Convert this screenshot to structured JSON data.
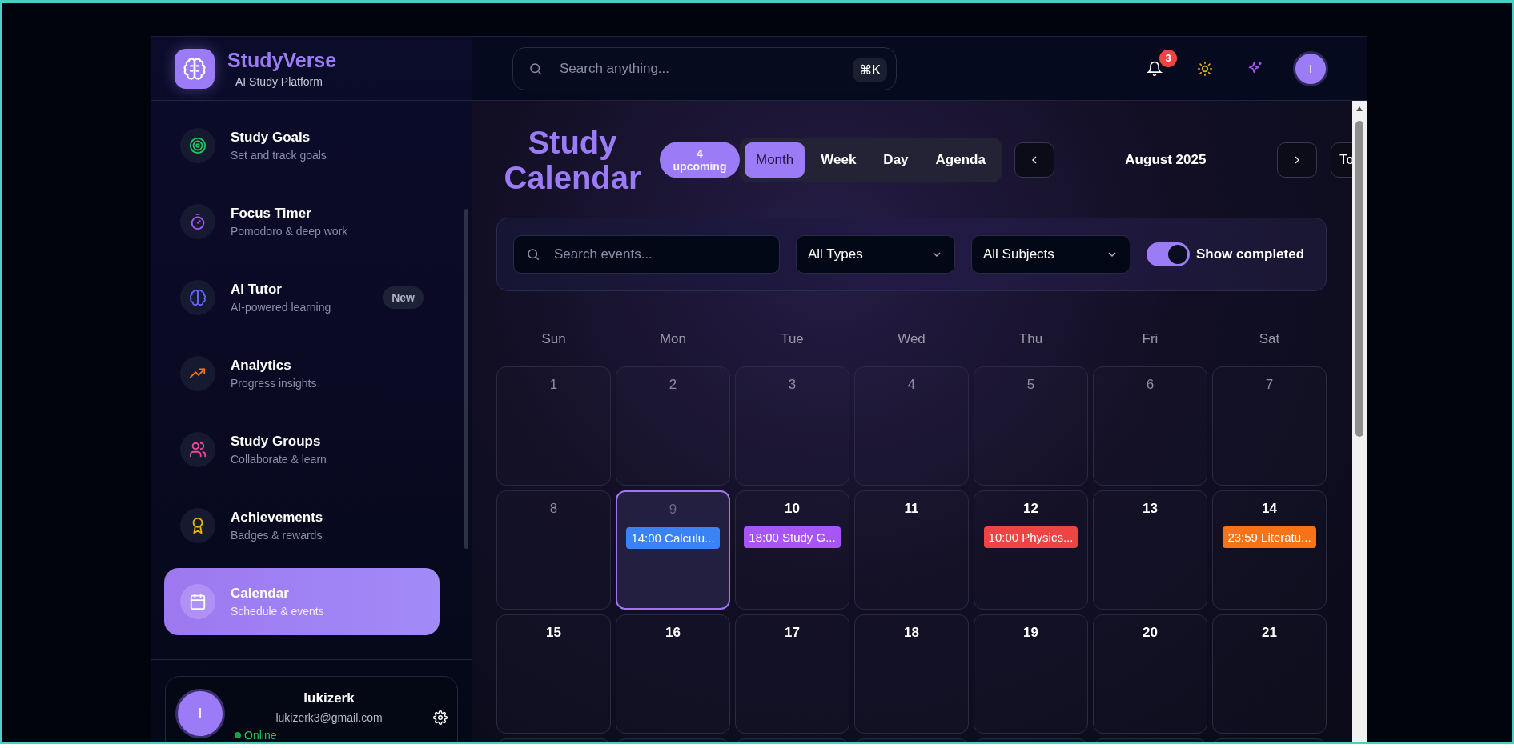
{
  "brand": {
    "name": "StudyVerse",
    "tagline": "AI Study Platform"
  },
  "nav": [
    {
      "label": "Study Goals",
      "sub": "Set and track goals",
      "kind": "target",
      "selected": false
    },
    {
      "label": "Focus Timer",
      "sub": "Pomodoro & deep work",
      "kind": "timer",
      "selected": false
    },
    {
      "label": "AI Tutor",
      "sub": "AI-powered learning",
      "kind": "brain",
      "badge": "New",
      "selected": false
    },
    {
      "label": "Analytics",
      "sub": "Progress insights",
      "kind": "trend",
      "selected": false
    },
    {
      "label": "Study Groups",
      "sub": "Collaborate & learn",
      "kind": "users",
      "selected": false
    },
    {
      "label": "Achievements",
      "sub": "Badges & rewards",
      "kind": "award",
      "selected": false
    },
    {
      "label": "Calendar",
      "sub": "Schedule & events",
      "kind": "calendar",
      "selected": true
    }
  ],
  "user": {
    "avatar": "I",
    "name": "lukizerk",
    "email": "lukizerk3@gmail.com",
    "status": "Online",
    "online": true
  },
  "header": {
    "search_placeholder": "Search anything...",
    "shortcut": "⌘K",
    "notifications": "3",
    "avatar": "I"
  },
  "calendar": {
    "title": "Study Calendar",
    "upcoming_count": "4",
    "upcoming_label": "upcoming",
    "views": [
      {
        "label": "Month",
        "selected": true
      },
      {
        "label": "Week",
        "selected": false
      },
      {
        "label": "Day",
        "selected": false
      },
      {
        "label": "Agenda",
        "selected": false
      }
    ],
    "month": "August 2025",
    "today_button": "To",
    "filters": {
      "search_placeholder": "Search events...",
      "type": "All Types",
      "subject": "All Subjects",
      "show_completed": {
        "label": "Show completed",
        "on": true
      }
    },
    "weekdays": [
      "Sun",
      "Mon",
      "Tue",
      "Wed",
      "Thu",
      "Fri",
      "Sat"
    ],
    "weeks": [
      [
        {
          "day": "1",
          "past": true,
          "selected": false
        },
        {
          "day": "2",
          "past": true,
          "selected": false
        },
        {
          "day": "3",
          "past": true,
          "selected": false
        },
        {
          "day": "4",
          "past": true,
          "selected": false
        },
        {
          "day": "5",
          "past": true,
          "selected": false
        },
        {
          "day": "6",
          "past": true,
          "selected": false
        },
        {
          "day": "7",
          "past": true,
          "selected": false
        }
      ],
      [
        {
          "day": "8",
          "past": true,
          "selected": false
        },
        {
          "day": "9",
          "past": true,
          "selected": true,
          "events": [
            {
              "text": "14:00 Calculu...",
              "color": "#3b82f6"
            }
          ]
        },
        {
          "day": "10",
          "past": false,
          "selected": false,
          "events": [
            {
              "text": "18:00 Study G...",
              "color": "#a855f7"
            }
          ]
        },
        {
          "day": "11",
          "past": false,
          "selected": false
        },
        {
          "day": "12",
          "past": false,
          "selected": false,
          "events": [
            {
              "text": "10:00 Physics...",
              "color": "#ef4444"
            }
          ]
        },
        {
          "day": "13",
          "past": false,
          "selected": false
        },
        {
          "day": "14",
          "past": false,
          "selected": false,
          "events": [
            {
              "text": "23:59 Literatu...",
              "color": "#f97316"
            }
          ]
        }
      ],
      [
        {
          "day": "15",
          "past": false,
          "selected": false
        },
        {
          "day": "16",
          "past": false,
          "selected": false
        },
        {
          "day": "17",
          "past": false,
          "selected": false
        },
        {
          "day": "18",
          "past": false,
          "selected": false
        },
        {
          "day": "19",
          "past": false,
          "selected": false
        },
        {
          "day": "20",
          "past": false,
          "selected": false
        },
        {
          "day": "21",
          "past": false,
          "selected": false
        }
      ]
    ]
  }
}
